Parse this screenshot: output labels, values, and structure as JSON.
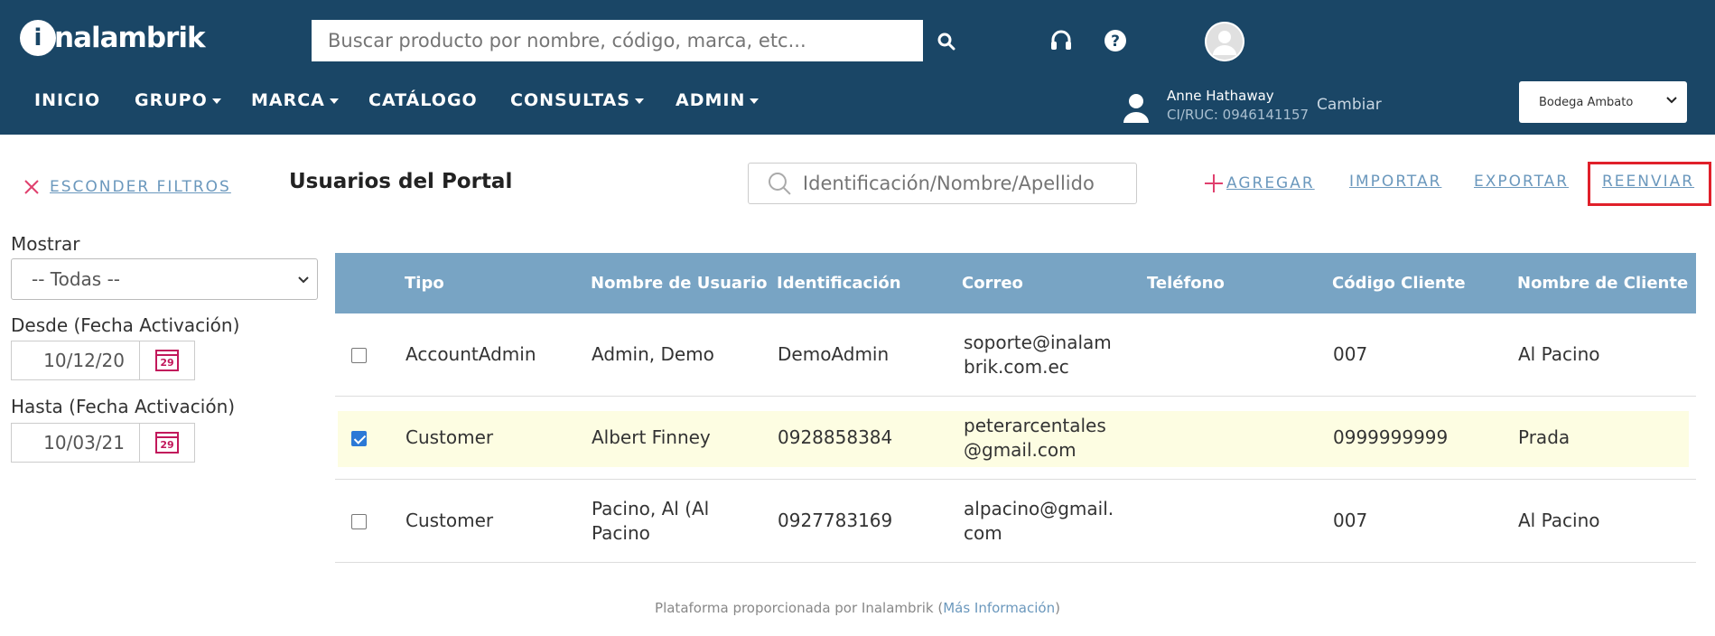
{
  "header": {
    "logo_mark": "i",
    "logo_text": "nalambrik",
    "search_placeholder": "Buscar producto por nombre, código, marca, etc...",
    "nav": [
      {
        "label": "INICIO",
        "has_caret": false
      },
      {
        "label": "GRUPO",
        "has_caret": true
      },
      {
        "label": "MARCA",
        "has_caret": true
      },
      {
        "label": "CATÁLOGO",
        "has_caret": false
      },
      {
        "label": "CONSULTAS",
        "has_caret": true
      },
      {
        "label": "ADMIN",
        "has_caret": true
      }
    ],
    "user_name": "Anne Hathaway",
    "user_ruc": "CI/RUC: 0946141157",
    "change_label": "Cambiar",
    "warehouse": "Bodega Ambato",
    "bg_color": "#1a4666"
  },
  "toolbar": {
    "hide_filters": "ESCONDER FILTROS",
    "page_title": "Usuarios del Portal",
    "filter_placeholder": "Identificación/Nombre/Apellido",
    "add": "AGREGAR",
    "import": "IMPORTAR",
    "export": "EXPORTAR",
    "resend": "REENVIAR",
    "link_color": "#6b98bd",
    "highlight_color": "#e0202a"
  },
  "sidebar": {
    "show_label": "Mostrar",
    "show_value": "-- Todas --",
    "from_label": "Desde (Fecha Activación)",
    "from_value": "10/12/20",
    "to_label": "Hasta (Fecha Activación)",
    "to_value": "10/03/21",
    "calendar_day": "29"
  },
  "table": {
    "columns": [
      "Tipo",
      "Nombre de Usuario",
      "Identificación",
      "Correo",
      "Teléfono",
      "Código Cliente",
      "Nombre de Cliente"
    ],
    "header_color": "#78a4c4",
    "rows": [
      {
        "checked": false,
        "tipo": "AccountAdmin",
        "usuario": "Admin, Demo",
        "id": "DemoAdmin",
        "correo_1": "soporte@inalam",
        "correo_2": "brik.com.ec",
        "telefono": "",
        "codigo": "007",
        "cliente": "Al Pacino"
      },
      {
        "checked": true,
        "tipo": "Customer",
        "usuario": "Albert Finney",
        "id": "0928858384",
        "correo_1": "peterarcentales",
        "correo_2": "@gmail.com",
        "telefono": "",
        "codigo": "0999999999",
        "cliente": "Prada"
      },
      {
        "checked": false,
        "tipo": "Customer",
        "usuario_1": "Pacino, Al (Al",
        "usuario_2": "Pacino",
        "id": "0927783169",
        "correo_1": "alpacino@gmail.",
        "correo_2": "com",
        "telefono": "",
        "codigo": "007",
        "cliente": "Al Pacino"
      }
    ]
  },
  "footer": {
    "text": "Plataforma proporcionada por Inalambrik (",
    "link": "Más Información",
    "close": ")"
  }
}
